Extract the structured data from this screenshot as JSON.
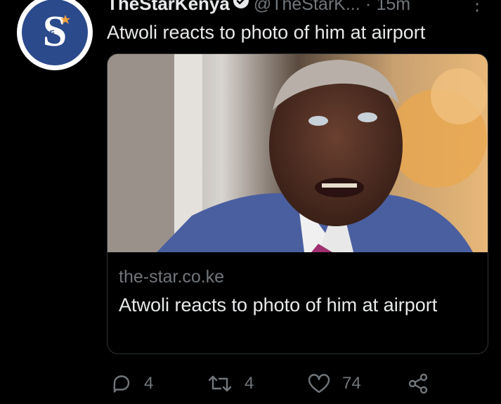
{
  "tweet": {
    "display_name": "TheStarKenya",
    "handle": "@TheStarK...",
    "separator": "·",
    "time": "15m",
    "text": "Atwoli reacts to photo of him at airport",
    "more_label": "⋮"
  },
  "card": {
    "domain": "the-star.co.ke",
    "title": "Atwoli reacts to photo of him at airport"
  },
  "actions": {
    "reply_count": "4",
    "retweet_count": "4",
    "like_count": "74"
  },
  "colors": {
    "background": "#000000",
    "text": "#e7e9ea",
    "muted": "#71767b",
    "avatar_blue": "#2b4a8c",
    "logo_orange": "#f2a23a"
  },
  "icons": [
    "verified-badge-icon",
    "reply-icon",
    "retweet-icon",
    "like-icon",
    "share-icon",
    "more-icon"
  ]
}
